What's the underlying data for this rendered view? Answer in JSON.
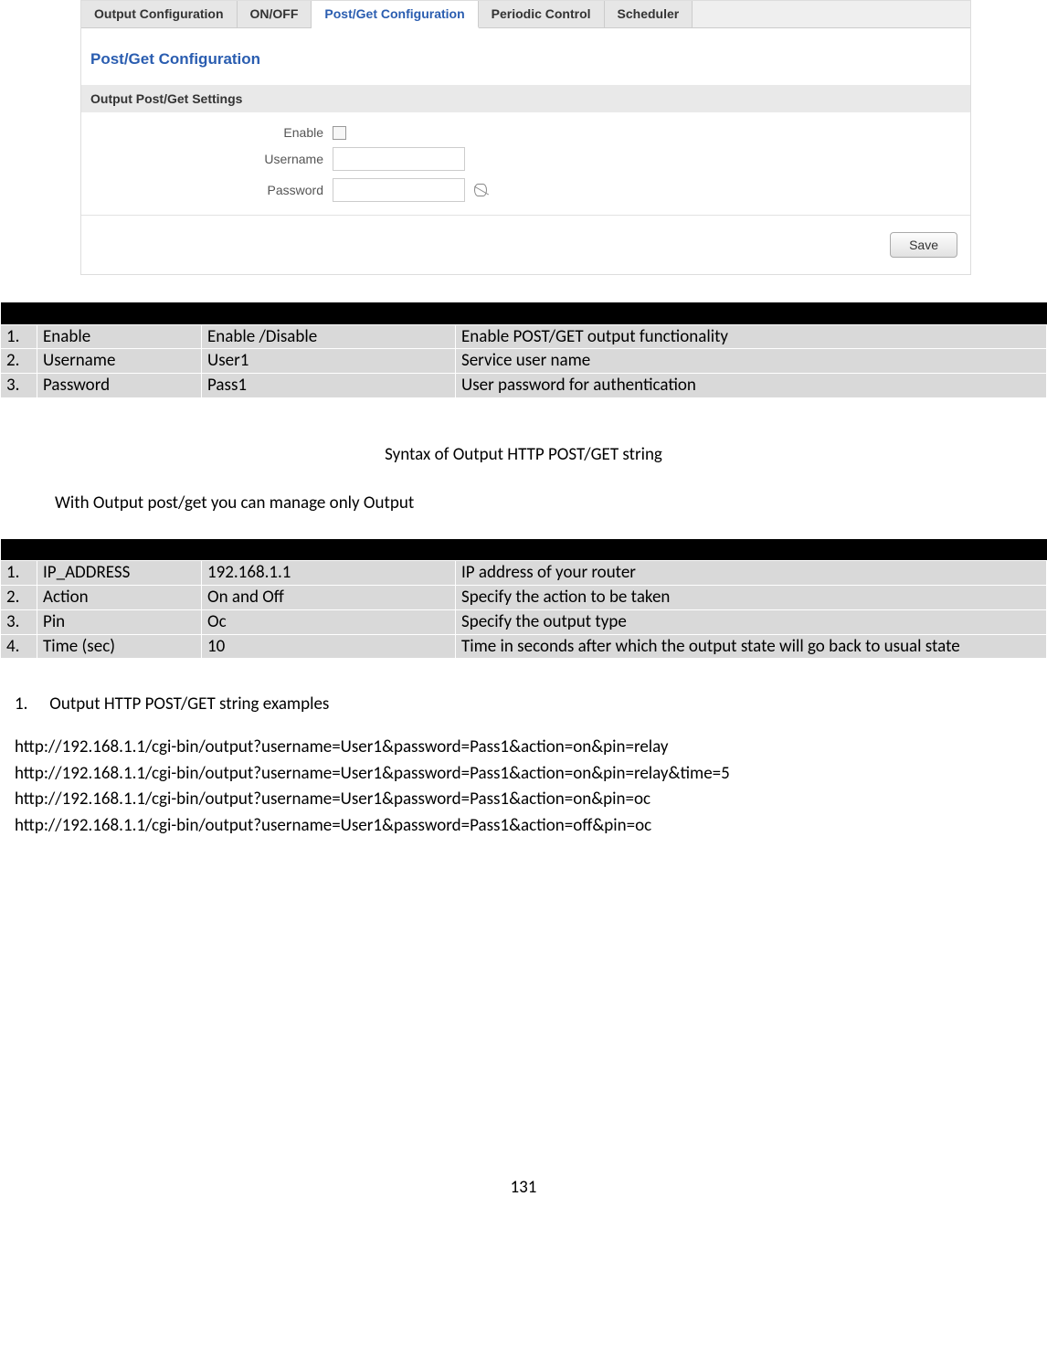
{
  "ui": {
    "tabs": [
      {
        "label": "Output Configuration"
      },
      {
        "label": "ON/OFF"
      },
      {
        "label": "Post/Get Configuration"
      },
      {
        "label": "Periodic Control"
      },
      {
        "label": "Scheduler"
      }
    ],
    "title": "Post/Get Configuration",
    "subhead": "Output Post/Get Settings",
    "enable_label": "Enable",
    "username_label": "Username",
    "password_label": "Password",
    "save_label": "Save"
  },
  "table1_head": {
    "c0": "",
    "c1": "",
    "c2": "",
    "c3": ""
  },
  "table1": [
    {
      "n": "1.",
      "name": "Enable",
      "value": "Enable /Disable",
      "desc": "Enable POST/GET output functionality"
    },
    {
      "n": "2.",
      "name": "Username",
      "value": "User1",
      "desc": "Service user name"
    },
    {
      "n": "3.",
      "name": "Password",
      "value": "Pass1",
      "desc": "User password for authentication"
    }
  ],
  "syntax_heading": "Syntax of Output HTTP POST/GET string",
  "body_line": "With Output post/get you can manage only Output",
  "table2_head": {
    "c0": "",
    "c1": "",
    "c2": "",
    "c3": ""
  },
  "table2": [
    {
      "n": "1.",
      "name": "IP_ADDRESS",
      "value": "192.168.1.1",
      "desc": "IP address of your router"
    },
    {
      "n": "2.",
      "name": "Action",
      "value": "On and Off",
      "desc": "Specify the action to be taken"
    },
    {
      "n": "3.",
      "name": "Pin",
      "value": "Oc",
      "desc": "Specify the output type"
    },
    {
      "n": "4.",
      "name": "Time (sec)",
      "value": "10",
      "desc": "Time in seconds after which the output state will go back to usual state"
    }
  ],
  "examples_num": "1.",
  "examples_heading": "Output HTTP POST/GET string examples",
  "urls": [
    "http://192.168.1.1/cgi-bin/output?username=User1&password=Pass1&action=on&pin=relay",
    "http://192.168.1.1/cgi-bin/output?username=User1&password=Pass1&action=on&pin=relay&time=5",
    "http://192.168.1.1/cgi-bin/output?username=User1&password=Pass1&action=on&pin=oc",
    "http://192.168.1.1/cgi-bin/output?username=User1&password=Pass1&action=off&pin=oc"
  ],
  "page_number": "131"
}
